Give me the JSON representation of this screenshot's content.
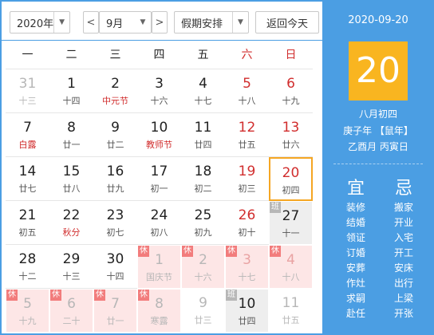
{
  "toolbar": {
    "year": "2020年",
    "prev": "<",
    "month": "9月",
    "next": ">",
    "holiday": "假期安排",
    "today_btn": "返回今天"
  },
  "weekdays": [
    "一",
    "二",
    "三",
    "四",
    "五",
    "六",
    "日"
  ],
  "weeks": [
    [
      {
        "n": "31",
        "s": "十三",
        "other": true
      },
      {
        "n": "1",
        "s": "十四"
      },
      {
        "n": "2",
        "s": "中元节",
        "sred": true
      },
      {
        "n": "3",
        "s": "十六"
      },
      {
        "n": "4",
        "s": "十七"
      },
      {
        "n": "5",
        "s": "十八",
        "red": true
      },
      {
        "n": "6",
        "s": "十九",
        "red": true
      }
    ],
    [
      {
        "n": "7",
        "s": "白露",
        "sred": true
      },
      {
        "n": "8",
        "s": "廿一"
      },
      {
        "n": "9",
        "s": "廿二"
      },
      {
        "n": "10",
        "s": "教师节",
        "sred": true
      },
      {
        "n": "11",
        "s": "廿四"
      },
      {
        "n": "12",
        "s": "廿五",
        "red": true
      },
      {
        "n": "13",
        "s": "廿六",
        "red": true
      }
    ],
    [
      {
        "n": "14",
        "s": "廿七"
      },
      {
        "n": "15",
        "s": "廿八"
      },
      {
        "n": "16",
        "s": "廿九"
      },
      {
        "n": "17",
        "s": "初一"
      },
      {
        "n": "18",
        "s": "初二"
      },
      {
        "n": "19",
        "s": "初三",
        "red": true
      },
      {
        "n": "20",
        "s": "初四",
        "red": true,
        "sel": true
      }
    ],
    [
      {
        "n": "21",
        "s": "初五"
      },
      {
        "n": "22",
        "s": "秋分",
        "sred": true
      },
      {
        "n": "23",
        "s": "初七"
      },
      {
        "n": "24",
        "s": "初八"
      },
      {
        "n": "25",
        "s": "初九"
      },
      {
        "n": "26",
        "s": "初十",
        "red": true
      },
      {
        "n": "27",
        "s": "十一",
        "badge": "班",
        "bt": "w"
      }
    ],
    [
      {
        "n": "28",
        "s": "十二"
      },
      {
        "n": "29",
        "s": "十三"
      },
      {
        "n": "30",
        "s": "十四"
      },
      {
        "n": "1",
        "s": "国庆节",
        "other": true,
        "badge": "休",
        "bt": "h"
      },
      {
        "n": "2",
        "s": "十六",
        "other": true,
        "badge": "休",
        "bt": "h"
      },
      {
        "n": "3",
        "s": "十七",
        "other": true,
        "red": true,
        "badge": "休",
        "bt": "h"
      },
      {
        "n": "4",
        "s": "十八",
        "other": true,
        "red": true,
        "badge": "休",
        "bt": "h"
      }
    ],
    [
      {
        "n": "5",
        "s": "十九",
        "other": true,
        "badge": "休",
        "bt": "h"
      },
      {
        "n": "6",
        "s": "二十",
        "other": true,
        "badge": "休",
        "bt": "h"
      },
      {
        "n": "7",
        "s": "廿一",
        "other": true,
        "badge": "休",
        "bt": "h"
      },
      {
        "n": "8",
        "s": "寒露",
        "other": true,
        "badge": "休",
        "bt": "h"
      },
      {
        "n": "9",
        "s": "廿三",
        "other": true
      },
      {
        "n": "10",
        "s": "廿四",
        "badge": "班",
        "bt": "w"
      },
      {
        "n": "11",
        "s": "廿五",
        "other": true
      }
    ]
  ],
  "panel": {
    "date": "2020-09-20",
    "day": "20",
    "lunar": "八月初四",
    "year": "庚子年 【鼠年】",
    "month": "乙酉月 丙寅日",
    "yi_label": "宜",
    "ji_label": "忌",
    "yi": [
      "装修",
      "结婚",
      "领证",
      "订婚",
      "安葬",
      "作灶",
      "求嗣",
      "赴任"
    ],
    "ji": [
      "搬家",
      "开业",
      "入宅",
      "开工",
      "安床",
      "出行",
      "上梁",
      "开张"
    ]
  },
  "colors": {
    "accent": "#4b9ee3",
    "today_box": "#f9b520",
    "holiday_bg": "#fde6e6",
    "workday_bg": "#eeeeee",
    "red": "#d12e2e"
  }
}
